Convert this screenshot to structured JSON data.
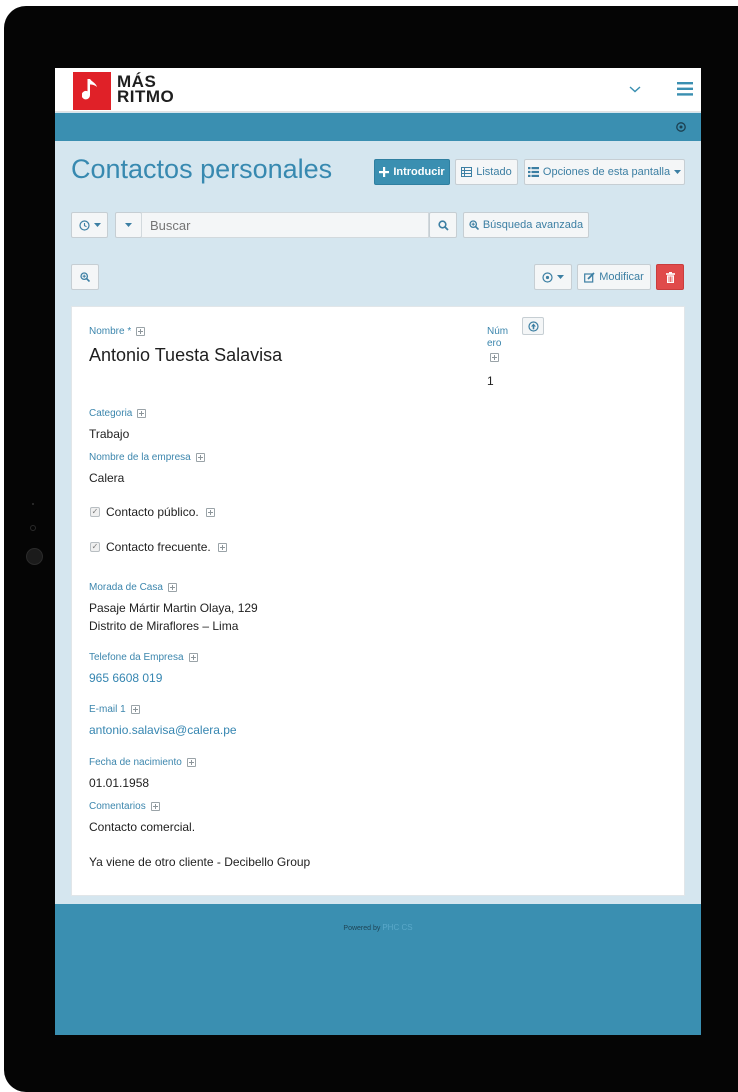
{
  "header": {
    "logo_line1": "MÁS",
    "logo_line2": "RITMO"
  },
  "page": {
    "title": "Contactos personales"
  },
  "toolbar": {
    "introduce_label": "Introducir",
    "list_label": "Listado",
    "options_label": "Opciones de esta pantalla"
  },
  "search": {
    "placeholder": "Buscar",
    "advanced_label": "Búsqueda avanzada"
  },
  "record_toolbar": {
    "modify_label": "Modificar"
  },
  "record": {
    "name_label": "Nombre *",
    "name_value": "Antonio Tuesta Salavisa",
    "number_label_1": "Núm",
    "number_label_2": "ero",
    "number_value": "1",
    "category_label": "Categoria",
    "category_value": "Trabajo",
    "company_label": "Nombre de la empresa",
    "company_value": "Calera",
    "public_label": "Contacto público.",
    "frequent_label": "Contacto frecuente.",
    "address_label": "Morada de Casa",
    "address_line1": "Pasaje Mártir Martin Olaya, 129",
    "address_line2": "Distrito de Miraflores – Lima",
    "phone_label": "Telefone da Empresa",
    "phone_value": "965 6608 019",
    "email_label": "E-mail 1",
    "email_value": "antonio.salavisa@calera.pe",
    "birth_label": "Fecha de nacimiento",
    "birth_value": "01.01.1958",
    "comments_label": "Comentarios",
    "comments_line1": "Contacto comercial.",
    "comments_line2": "Ya viene de otro cliente - Decibello Group"
  },
  "footer": {
    "powered_by": "Powered by",
    "brand": "PHC CS"
  },
  "colors": {
    "accent": "#3a8fb1",
    "title": "#3789b0",
    "danger": "#e04b4b",
    "logo_red": "#e02128",
    "background": "#d5e6ef"
  }
}
